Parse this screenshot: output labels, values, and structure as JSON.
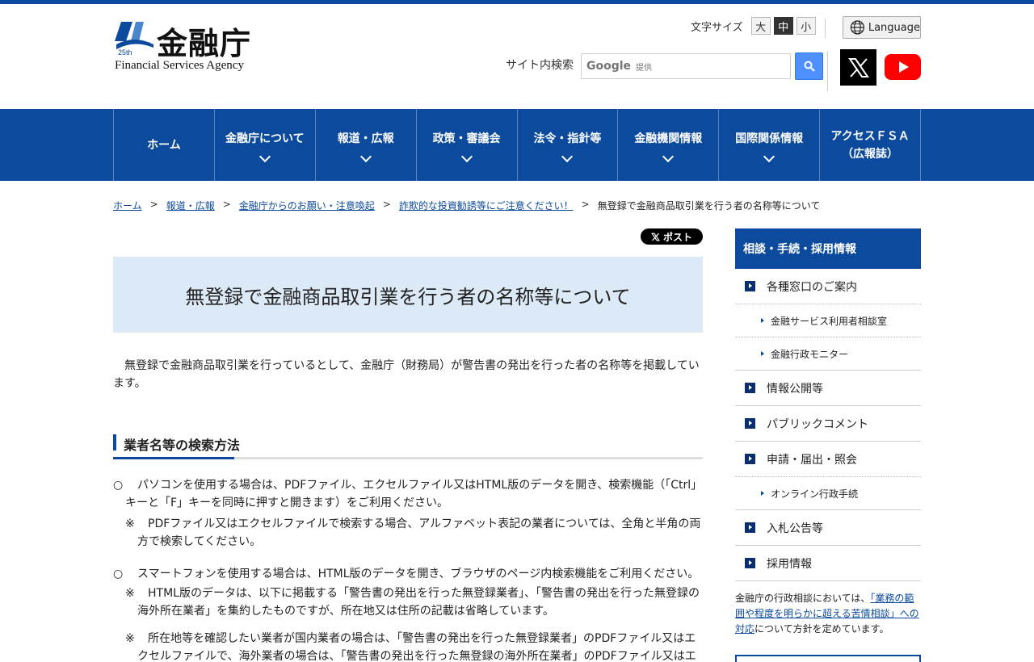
{
  "header": {
    "logo_title": "金融庁",
    "logo_sub": "Financial Services Agency",
    "font_size": {
      "label": "文字サイズ",
      "large": "大",
      "medium": "中",
      "small": "小",
      "selected": "中"
    },
    "language_label": "Language",
    "search": {
      "label": "サイト内検索",
      "google": "Google",
      "provided": "提供",
      "placeholder": ""
    },
    "icons": {
      "search": "search-icon",
      "x": "x-logo-icon",
      "youtube": "youtube-icon",
      "globe": "globe-icon"
    }
  },
  "nav": {
    "items": [
      {
        "label": "ホーム"
      },
      {
        "label": "金融庁について"
      },
      {
        "label": "報道・広報"
      },
      {
        "label": "政策・審議会"
      },
      {
        "label": "法令・指針等"
      },
      {
        "label": "金融機関情報"
      },
      {
        "label": "国際関係情報"
      },
      {
        "label": "アクセスＦＳＡ",
        "label2": "（広報誌）"
      }
    ]
  },
  "breadcrumb": {
    "items": [
      "ホーム",
      "報道・広報",
      "金融庁からのお願い・注意喚起",
      "詐欺的な投資勧誘等にご注意ください！"
    ],
    "current": "無登録で金融商品取引業を行う者の名称等について",
    "sep": ">"
  },
  "post_button": "ポスト",
  "page_title": "無登録で金融商品取引業を行う者の名称等について",
  "intro": "無登録で金融商品取引業を行っているとして、金融庁（財務局）が警告書の発出を行った者の名称等を掲載しています。",
  "section": {
    "heading": "業者名等の検索方法",
    "bullets": [
      {
        "mark": "○",
        "text": "パソコンを使用する場合は、PDFファイル、エクセルファイル又はHTML版のデータを開き、検索機能（「Ctrl」キーと「F」キーを同時に押すと開きます）をご利用ください。"
      },
      {
        "mark": "○",
        "text": "スマートフォンを使用する場合は、HTML版のデータを開き、ブラウザのページ内検索機能をご利用ください。"
      }
    ],
    "notes": [
      {
        "mark": "※",
        "text": "PDFファイル又はエクセルファイルで検索する場合、アルファベット表記の業者については、全角と半角の両方で検索してください。"
      },
      {
        "mark": "※",
        "text": "HTML版のデータは、以下に掲載する「警告書の発出を行った無登録業者」、「警告書の発出を行った無登録の海外所在業者」を集約したものですが、所在地又は住所の記載は省略しています。"
      },
      {
        "mark": "※",
        "text": "所在地等を確認したい業者が国内業者の場合は、「警告書の発出を行った無登録業者」のPDFファイル又はエクセルファイルで、海外業者の場合は、「警告書の発出を行った無登録の海外所在業者」のPDFファイル又はエ"
      }
    ]
  },
  "sidebar": {
    "heading": "相談・手続・採用情報",
    "items": [
      {
        "label": "各種窓口のご案内"
      },
      {
        "label": "金融サービス利用者相談室"
      },
      {
        "label": "金融行政モニター"
      },
      {
        "label": "情報公開等"
      },
      {
        "label": "パブリックコメント"
      },
      {
        "label": "申請・届出・照会"
      },
      {
        "label": "オンライン行政手続"
      },
      {
        "label": "入札公告等"
      },
      {
        "label": "採用情報"
      }
    ],
    "note_pre": "金融庁の行政相談においては、",
    "note_link": "「業務の範囲や程度を明らかに超える苦情相談」への対応",
    "note_post": "について方針を定めています。"
  },
  "colors": {
    "brand": "#0b4a9c",
    "title_bg": "#dce9f7",
    "youtube": "#ff0000",
    "search_btn": "#4d90fe"
  }
}
